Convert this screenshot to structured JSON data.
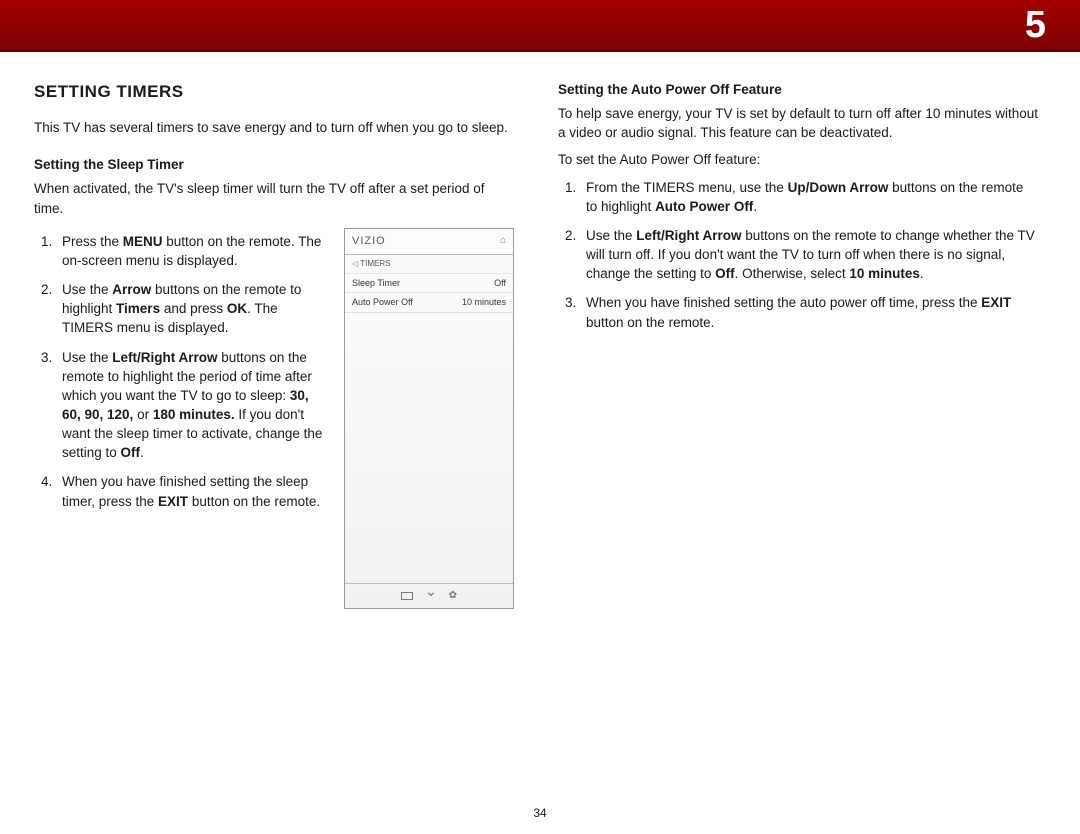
{
  "chapter": "5",
  "page_number": "34",
  "section_heading": "SETTING TIMERS",
  "intro": "This TV has several timers to save energy and to turn off when you go to sleep.",
  "sleep": {
    "heading": "Setting the Sleep Timer",
    "intro": "When activated, the TV's sleep timer will turn the TV off after a set period of time.",
    "step1_a": "Press the ",
    "step1_b": "MENU",
    "step1_c": " button on the remote. The on-screen menu is displayed.",
    "step2_a": "Use the ",
    "step2_b": "Arrow",
    "step2_c": " buttons on the remote to highlight ",
    "step2_d": "Timers",
    "step2_e": " and press ",
    "step2_f": "OK",
    "step2_g": ". The TIMERS menu is displayed.",
    "step3_a": "Use the ",
    "step3_b": "Left/Right Arrow",
    "step3_c": " buttons on the remote to highlight the period of time after which you want the TV to go to sleep: ",
    "step3_d": "30, 60, 90, 120,",
    "step3_e": " or ",
    "step3_f": "180 minutes.",
    "step3_g": " If you don't want the sleep timer to activate, change the setting to ",
    "step3_h": "Off",
    "step3_i": ".",
    "step4_a": "When you have finished setting the sleep timer, press the ",
    "step4_b": "EXIT",
    "step4_c": " button on the remote."
  },
  "auto": {
    "heading": "Setting the Auto Power Off Feature",
    "intro": "To help save energy, your TV is set by default to turn off after 10 minutes without a video or audio signal. This feature can be deactivated.",
    "lead": "To set the Auto Power Off feature:",
    "step1_a": "From the TIMERS menu, use the ",
    "step1_b": "Up/Down Arrow",
    "step1_c": " buttons on the remote to highlight ",
    "step1_d": "Auto Power Off",
    "step1_e": ".",
    "step2_a": "Use the ",
    "step2_b": "Left/Right Arrow",
    "step2_c": " buttons on the remote to change whether the TV will turn off. If you don't want the TV to turn off when there is no signal, change the setting to ",
    "step2_d": "Off",
    "step2_e": ". Otherwise, select ",
    "step2_f": "10 minutes",
    "step2_g": ".",
    "step3_a": "When you have finished setting the auto power off time, press the ",
    "step3_b": "EXIT",
    "step3_c": " button on the remote."
  },
  "tvmenu": {
    "logo": "VIZIO",
    "title": "TIMERS",
    "row1_label": "Sleep Timer",
    "row1_value": "Off",
    "row2_label": "Auto Power Off",
    "row2_value": "10 minutes"
  }
}
